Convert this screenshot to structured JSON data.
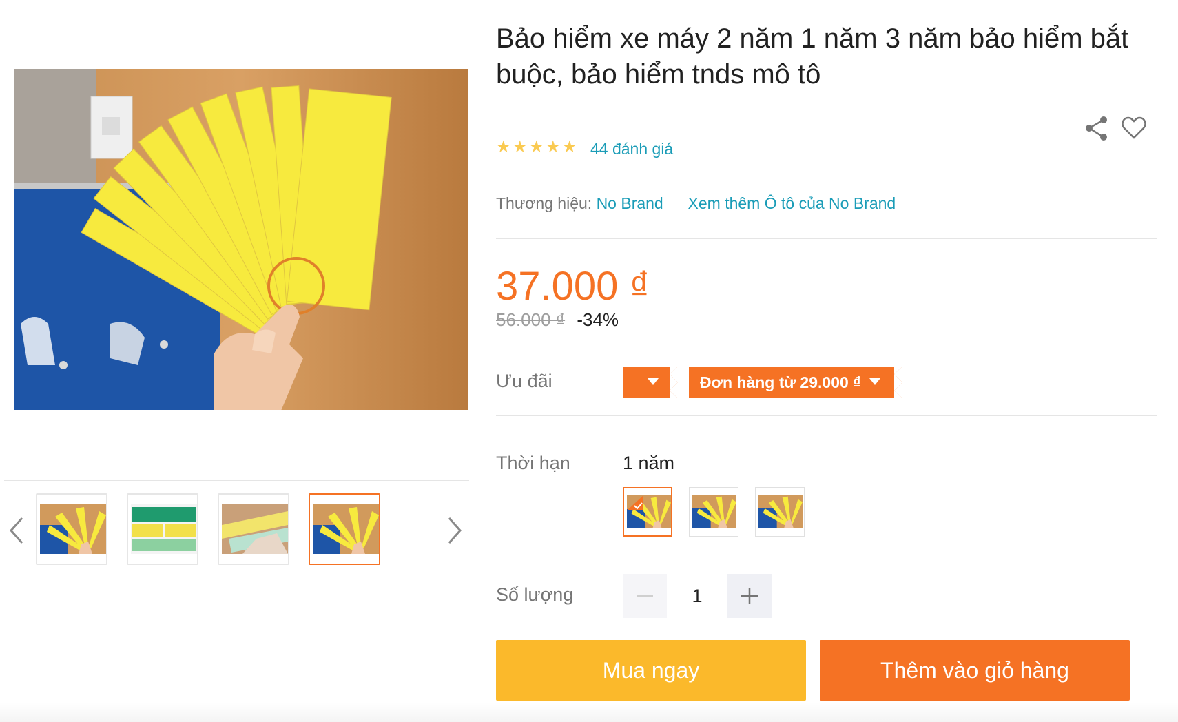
{
  "product": {
    "title": "Bảo hiểm xe máy 2 năm 1 năm 3 năm bảo hiểm bắt buộc, bảo hiểm tnds mô tô",
    "rating": 5,
    "rating_count_label": "44 đánh giá",
    "brand_label": "Thương hiệu:",
    "brand_name": "No Brand",
    "brand_more_link": "Xem thêm Ô tô của No Brand"
  },
  "pricing": {
    "price": "37.000 ₫",
    "original_price": "56.000 ₫",
    "discount": "-34%"
  },
  "promotions": {
    "label": "Ưu đãi",
    "voucher_text": "Đơn hàng từ 29.000 ₫"
  },
  "variant": {
    "label": "Thời hạn",
    "selected_value": "1 năm",
    "option_count": 3,
    "selected_index": 0
  },
  "quantity": {
    "label": "Số lượng",
    "value": "1"
  },
  "actions": {
    "buy_now": "Mua ngay",
    "add_to_cart": "Thêm vào giỏ hàng"
  },
  "gallery": {
    "thumbnail_count": 4,
    "active_thumbnail": 4
  },
  "icons": {
    "share": "share-icon",
    "wishlist": "heart-outline-icon",
    "prev": "chevron-left-icon",
    "next": "chevron-right-icon",
    "minus": "minus-icon",
    "plus": "plus-icon"
  },
  "colors": {
    "accent_orange": "#f57224",
    "buy_yellow": "#fbb92b",
    "link_teal": "#1a9cb7",
    "star_gold": "#faca51",
    "ticket_yellow": "#f7ea3e"
  }
}
